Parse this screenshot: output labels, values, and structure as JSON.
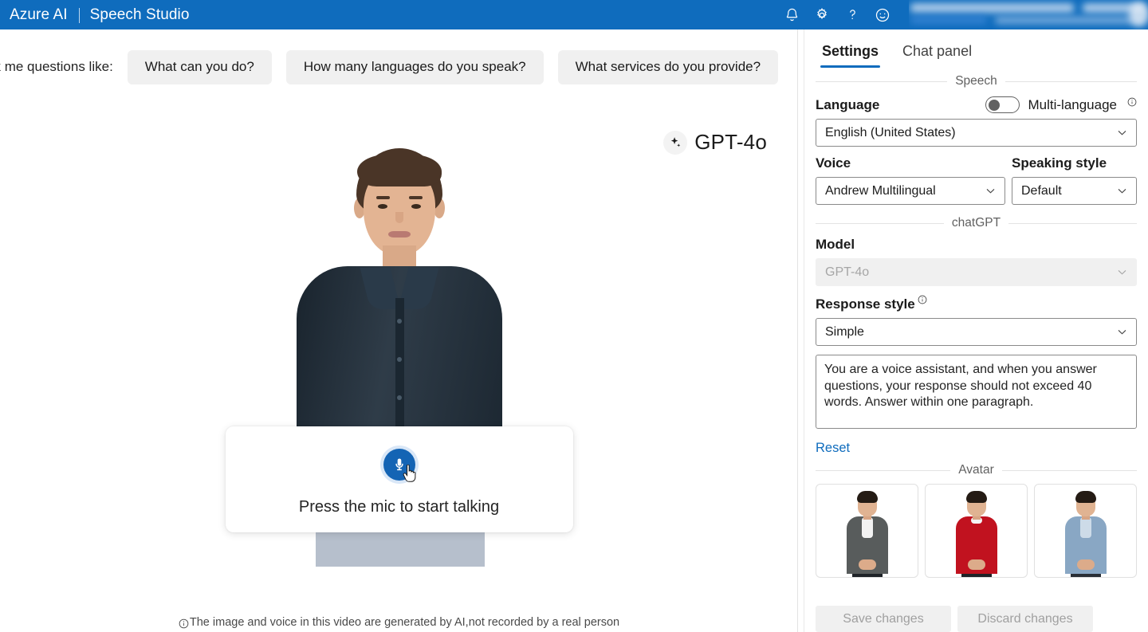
{
  "header": {
    "brand_primary": "Azure AI",
    "brand_separator": "|",
    "brand_secondary": "Speech Studio",
    "background_color": "#0f6cbd",
    "icons": [
      {
        "name": "notifications-icon",
        "glyph": "bell"
      },
      {
        "name": "settings-gear-icon",
        "glyph": "gear"
      },
      {
        "name": "help-icon",
        "glyph": "question-mark"
      },
      {
        "name": "feedback-smiley-icon",
        "glyph": "smiley"
      }
    ],
    "account_area": "blurred-account-info"
  },
  "main": {
    "suggestions_label": "sk me questions like:",
    "suggestions": [
      "What can you do?",
      "How many languages do you speak?",
      "What services do you provide?"
    ],
    "model_badge": {
      "icon": "sparkle-icon",
      "label": "GPT-4o"
    },
    "mic_card": {
      "icon": "microphone-icon",
      "prompt": "Press the mic to start talking",
      "cursor": "hand-pointer-cursor",
      "mic_color": "#1464b4"
    },
    "disclaimer": {
      "icon": "info-icon",
      "text": "The image and voice in this video are generated by AI,not recorded by a real person"
    }
  },
  "panel": {
    "tabs": [
      {
        "label": "Settings",
        "active": true
      },
      {
        "label": "Chat panel",
        "active": false
      }
    ],
    "sections": {
      "speech": {
        "title": "Speech",
        "language_label": "Language",
        "multilanguage_label": "Multi-language",
        "multilanguage_on": false,
        "language_value": "English (United States)",
        "voice_label": "Voice",
        "voice_value": "Andrew Multilingual",
        "speaking_style_label": "Speaking style",
        "speaking_style_value": "Default"
      },
      "chatgpt": {
        "title": "chatGPT",
        "model_label": "Model",
        "model_value": "GPT-4o",
        "model_disabled": true,
        "response_style_label": "Response style",
        "response_style_value": "Simple",
        "system_prompt": "You are a voice assistant, and when you answer questions, your response should not exceed 40 words. Answer within one paragraph.",
        "reset_label": "Reset"
      },
      "avatar": {
        "title": "Avatar",
        "options": [
          {
            "name": "avatar-lisa-grey-suit",
            "outfit_color": "#585c5c",
            "inner_color": "#f2f2f2",
            "legs_color": "#1f2328"
          },
          {
            "name": "avatar-red-sweater",
            "outfit_color": "#c1121f",
            "inner_color": "#f4f4f4",
            "legs_color": "#1f2328"
          },
          {
            "name": "avatar-blue-denim-shirt",
            "outfit_color": "#89a7c4",
            "inner_color": "#cddbe8",
            "legs_color": "#2a2f36"
          }
        ]
      }
    },
    "footer": {
      "save_label": "Save changes",
      "discard_label": "Discard changes",
      "disabled": true
    },
    "accent_color": "#0f6cbd"
  }
}
